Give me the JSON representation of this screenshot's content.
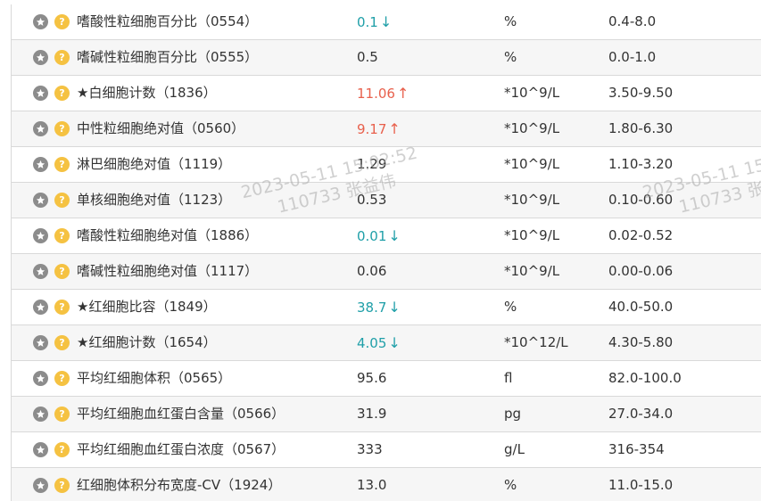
{
  "rows": [
    {
      "name": "嗜酸性粒细胞百分比（0554）",
      "result": "0.1",
      "flag": "low",
      "arrow": "↓",
      "unit": "%",
      "range": "0.4-8.0"
    },
    {
      "name": "嗜碱性粒细胞百分比（0555）",
      "result": "0.5",
      "flag": "",
      "arrow": "",
      "unit": "%",
      "range": "0.0-1.0"
    },
    {
      "name": "★白细胞计数（1836）",
      "result": "11.06",
      "flag": "high",
      "arrow": "↑",
      "unit": "*10^9/L",
      "range": "3.50-9.50"
    },
    {
      "name": "中性粒细胞绝对值（0560）",
      "result": "9.17",
      "flag": "high",
      "arrow": "↑",
      "unit": "*10^9/L",
      "range": "1.80-6.30"
    },
    {
      "name": "淋巴细胞绝对值（1119）",
      "result": "1.29",
      "flag": "",
      "arrow": "",
      "unit": "*10^9/L",
      "range": "1.10-3.20"
    },
    {
      "name": "单核细胞绝对值（1123）",
      "result": "0.53",
      "flag": "",
      "arrow": "",
      "unit": "*10^9/L",
      "range": "0.10-0.60"
    },
    {
      "name": "嗜酸性粒细胞绝对值（1886）",
      "result": "0.01",
      "flag": "low",
      "arrow": "↓",
      "unit": "*10^9/L",
      "range": "0.02-0.52"
    },
    {
      "name": "嗜碱性粒细胞绝对值（1117）",
      "result": "0.06",
      "flag": "",
      "arrow": "",
      "unit": "*10^9/L",
      "range": "0.00-0.06"
    },
    {
      "name": "★红细胞比容（1849）",
      "result": "38.7",
      "flag": "low",
      "arrow": "↓",
      "unit": "%",
      "range": "40.0-50.0"
    },
    {
      "name": "★红细胞计数（1654）",
      "result": "4.05",
      "flag": "low",
      "arrow": "↓",
      "unit": "*10^12/L",
      "range": "4.30-5.80"
    },
    {
      "name": "平均红细胞体积（0565）",
      "result": "95.6",
      "flag": "",
      "arrow": "",
      "unit": "fl",
      "range": "82.0-100.0"
    },
    {
      "name": "平均红细胞血红蛋白含量（0566）",
      "result": "31.9",
      "flag": "",
      "arrow": "",
      "unit": "pg",
      "range": "27.0-34.0"
    },
    {
      "name": "平均红细胞血红蛋白浓度（0567）",
      "result": "333",
      "flag": "",
      "arrow": "",
      "unit": "g/L",
      "range": "316-354"
    },
    {
      "name": "红细胞体积分布宽度-CV（1924）",
      "result": "13.0",
      "flag": "",
      "arrow": "",
      "unit": "%",
      "range": "11.0-15.0"
    }
  ],
  "watermark": {
    "timestamp": "2023-05-11 15:02:52",
    "user": "110733 张益伟",
    "timestamp_partial": "2023-05-11 15",
    "user_partial": "110733 张"
  },
  "colors": {
    "low": "#1f9fa8",
    "high": "#e8604c",
    "star_icon": "#8c8c8c",
    "help_icon": "#f5c242"
  },
  "icons": {
    "star": "star-icon",
    "help": "help-icon"
  }
}
